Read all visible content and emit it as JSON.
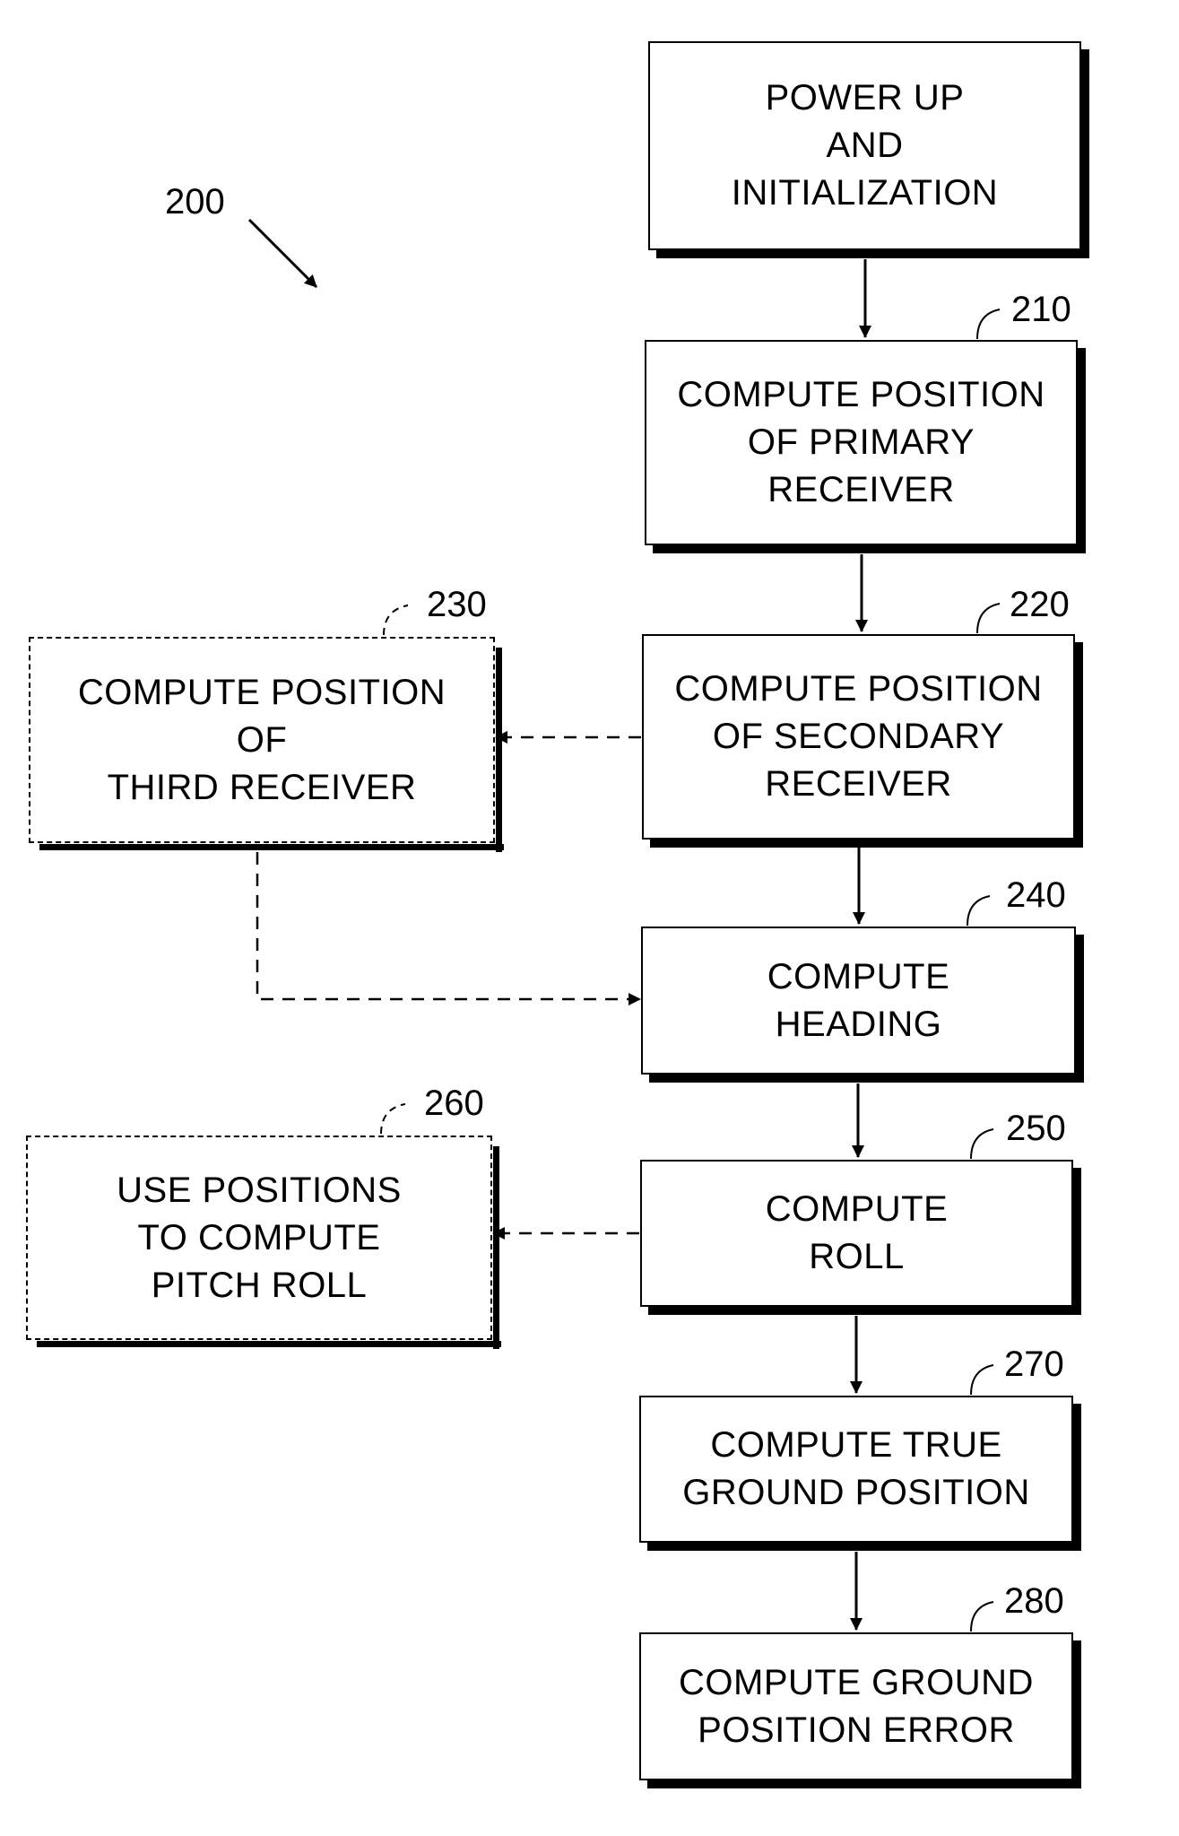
{
  "figure": {
    "reference": "200",
    "steps": [
      {
        "id": "init",
        "ref": "",
        "text": "POWER UP\nAND\nINITIALIZATION",
        "style": "solid"
      },
      {
        "id": "primary",
        "ref": "210",
        "text": "COMPUTE POSITION\nOF PRIMARY\nRECEIVER",
        "style": "solid"
      },
      {
        "id": "secondary",
        "ref": "220",
        "text": "COMPUTE POSITION\nOF SECONDARY\nRECEIVER",
        "style": "solid"
      },
      {
        "id": "third",
        "ref": "230",
        "text": "COMPUTE POSITION\nOF\nTHIRD RECEIVER",
        "style": "dashed"
      },
      {
        "id": "heading",
        "ref": "240",
        "text": "COMPUTE\nHEADING",
        "style": "solid"
      },
      {
        "id": "roll",
        "ref": "250",
        "text": "COMPUTE\nROLL",
        "style": "solid"
      },
      {
        "id": "pitch",
        "ref": "260",
        "text": "USE POSITIONS\nTO COMPUTE\nPITCH ROLL",
        "style": "dashed"
      },
      {
        "id": "ground",
        "ref": "270",
        "text": "COMPUTE TRUE\nGROUND POSITION",
        "style": "solid"
      },
      {
        "id": "error",
        "ref": "280",
        "text": "COMPUTE GROUND\nPOSITION ERROR",
        "style": "solid"
      }
    ],
    "connections": [
      {
        "from": "init",
        "to": "primary",
        "style": "solid"
      },
      {
        "from": "primary",
        "to": "secondary",
        "style": "solid"
      },
      {
        "from": "secondary",
        "to": "third",
        "style": "dashed"
      },
      {
        "from": "secondary",
        "to": "heading",
        "style": "solid"
      },
      {
        "from": "third",
        "to": "heading",
        "style": "dashed"
      },
      {
        "from": "heading",
        "to": "roll",
        "style": "solid"
      },
      {
        "from": "roll",
        "to": "pitch",
        "style": "dashed"
      },
      {
        "from": "roll",
        "to": "ground",
        "style": "solid"
      },
      {
        "from": "ground",
        "to": "error",
        "style": "solid"
      }
    ]
  }
}
